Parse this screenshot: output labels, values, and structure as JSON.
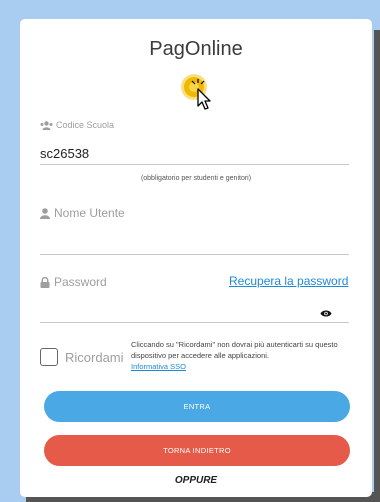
{
  "app": {
    "title": "PagOnline"
  },
  "colors": {
    "primary": "#4aa9e4",
    "danger": "#e55a49",
    "link": "#1e8ad6",
    "background": "#a9cdf1"
  },
  "school_code": {
    "icon": "users-icon",
    "label": "Codice Scuola",
    "value": "sc26538",
    "hint": "(obbligatorio per studenti e genitori)"
  },
  "username": {
    "icon": "user-icon",
    "label": "Nome Utente",
    "value": ""
  },
  "password": {
    "icon": "lock-icon",
    "label": "Password",
    "recover_link": "Recupera la password",
    "toggle_icon": "eye-icon",
    "value": ""
  },
  "remember": {
    "label": "Ricordami",
    "description": "Cliccando su \"Ricordami\" non dovrai più autenticarti su questo dispositivo per accedere alle applicazioni.",
    "sso_link": "Informativa SSO",
    "checked": false
  },
  "buttons": {
    "login": "ENTRA",
    "back": "TORNA INDIETRO"
  },
  "divider": {
    "oppure": "OPPURE"
  }
}
